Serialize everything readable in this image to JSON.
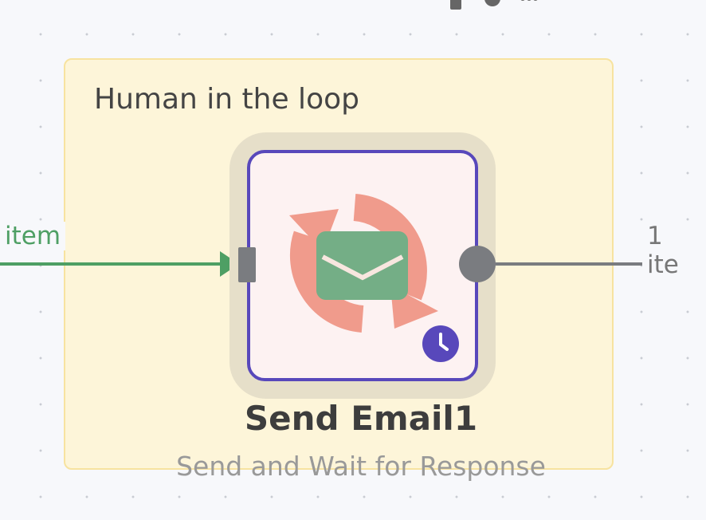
{
  "sticky_note": {
    "title": "Human in the loop"
  },
  "connections": {
    "input_label": "item",
    "output_label": "1 ite"
  },
  "node": {
    "title": "Send Email1",
    "subtitle": "Send and Wait for Response",
    "icon": "email-send-wait-icon",
    "badge_icon": "clock-icon"
  },
  "colors": {
    "node_border": "#5848bb",
    "success_wire": "#4e9f64",
    "sticky_bg": "#fdf5d9"
  }
}
